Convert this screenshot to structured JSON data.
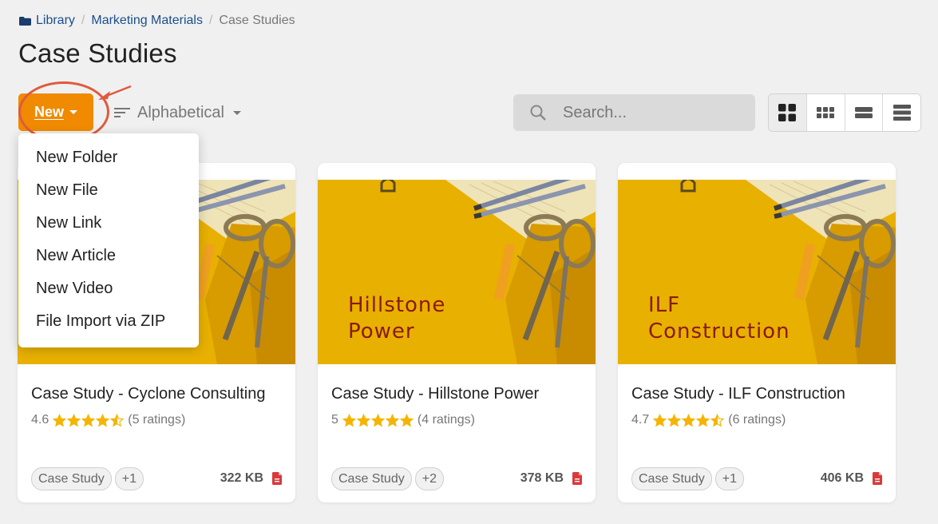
{
  "breadcrumb": {
    "items": [
      "Library",
      "Marketing Materials"
    ],
    "current": "Case Studies"
  },
  "page_title": "Case Studies",
  "toolbar": {
    "new_label": "New",
    "sort_label": "Alphabetical",
    "search_placeholder": "Search...",
    "view_modes": [
      "large-grid-icon",
      "small-grid-icon",
      "list-icon",
      "compact-list-icon"
    ],
    "active_view": "large-grid-icon"
  },
  "new_menu": {
    "items": [
      "New Folder",
      "New File",
      "New Link",
      "New Article",
      "New Video",
      "File Import via ZIP"
    ]
  },
  "cards": [
    {
      "title": "Case Study - Cyclone Consulting",
      "thumb_text": "",
      "rating": "4.6",
      "rating_value": 4.6,
      "ratings_count": "(5 ratings)",
      "tag": "Case Study",
      "extra_tags": "+1",
      "size": "322 KB",
      "file_icon": "pdf-icon"
    },
    {
      "title": "Case Study - Hillstone Power",
      "thumb_text": "Hillstone\nPower",
      "rating": "5",
      "rating_value": 5,
      "ratings_count": "(4 ratings)",
      "tag": "Case Study",
      "extra_tags": "+2",
      "size": "378 KB",
      "file_icon": "pdf-icon"
    },
    {
      "title": "Case Study - ILF Construction",
      "thumb_text": "ILF\nConstruction",
      "rating": "4.7",
      "rating_value": 4.7,
      "ratings_count": "(6 ratings)",
      "tag": "Case Study",
      "extra_tags": "+1",
      "size": "406 KB",
      "file_icon": "pdf-icon"
    }
  ],
  "colors": {
    "accent": "#f08a00",
    "link": "#1a4f8b",
    "annotation": "#e05a3c",
    "star": "#f5b400",
    "pdf": "#d93a3a",
    "thumb_bg": "#e8b000"
  }
}
